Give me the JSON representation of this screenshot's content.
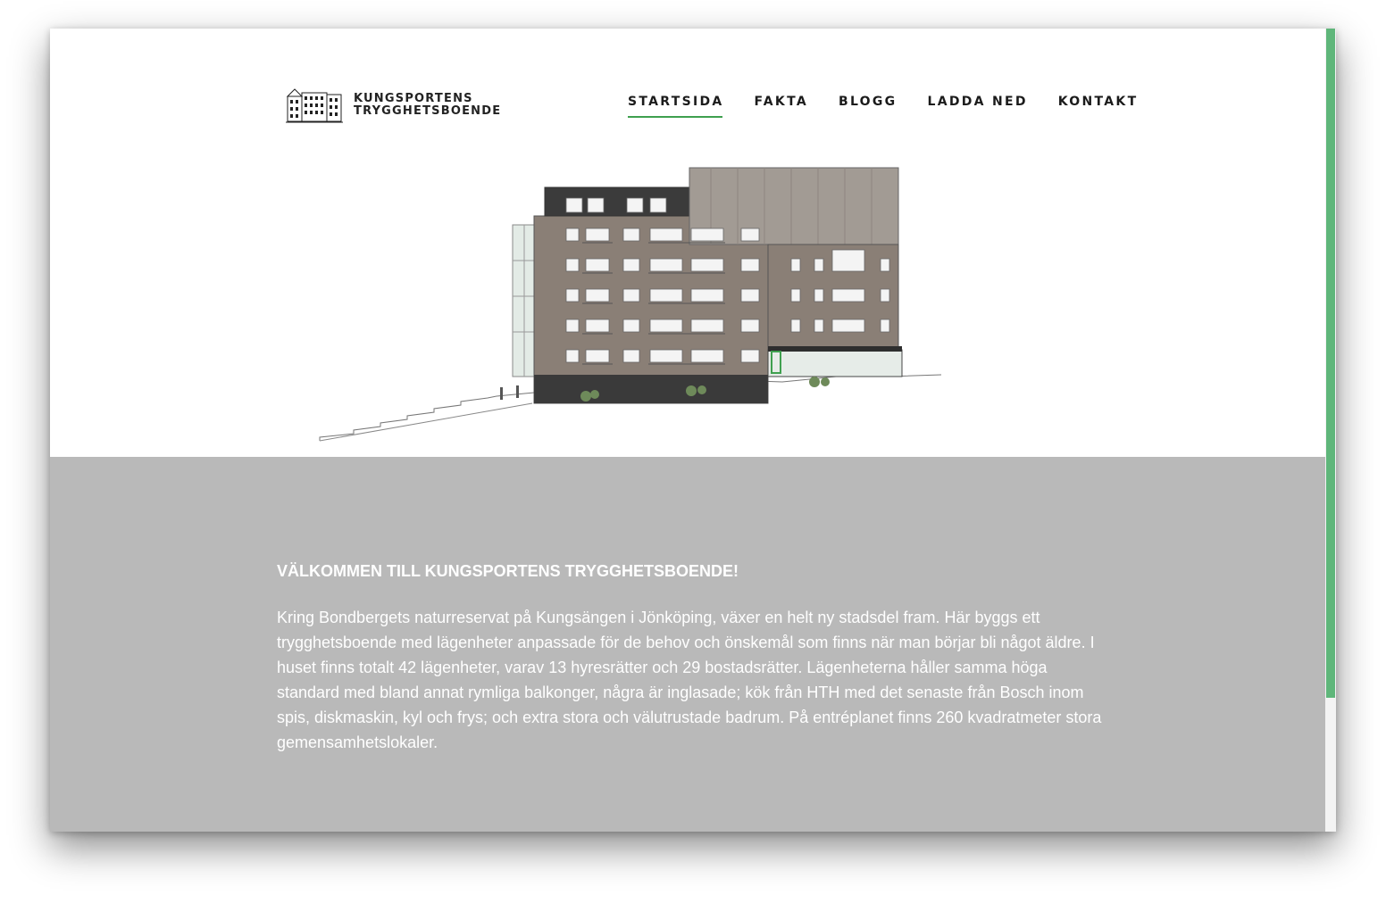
{
  "site": {
    "logo_line1": "KUNGSPORTENS",
    "logo_line2": "TRYGGHETSBOENDE"
  },
  "nav": {
    "items": [
      {
        "label": "STARTSIDA",
        "active": true
      },
      {
        "label": "FAKTA",
        "active": false
      },
      {
        "label": "BLOGG",
        "active": false
      },
      {
        "label": "LADDA NED",
        "active": false
      },
      {
        "label": "KONTAKT",
        "active": false
      }
    ]
  },
  "hero": {
    "image": "building-elevation-illustration"
  },
  "main": {
    "title": "VÄLKOMMEN TILL KUNGSPORTENS TRYGGHETSBOENDE!",
    "body": "Kring Bondbergets naturreservat på Kungsängen i Jönköping, växer en helt ny stadsdel fram. Här byggs ett trygghetsboende med lägenheter anpassade för de behov och önskemål som finns när man börjar bli något äldre. I huset finns totalt 42 lägenheter, varav 13 hyresrätter och 29 bostadsrätter. Lägenheterna håller samma höga standard med bland annat rymliga balkonger, några är inglasade; kök från HTH med det senaste från Bosch inom spis, diskmaskin, kyl och frys; och extra stora och välutrustade badrum. På entréplanet finns 260 kvadratmeter stora gemensamhetslokaler."
  },
  "colors": {
    "accent": "#3fa04f",
    "scrollbar": "#5fb67a",
    "content_bg": "#b9b9b9",
    "facade": "#8a7f76"
  }
}
